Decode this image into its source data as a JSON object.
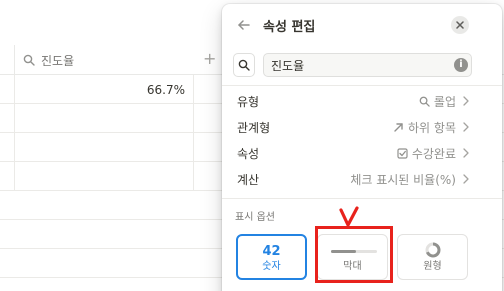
{
  "background_table": {
    "header_label": "진도율",
    "header_icon": "search-icon",
    "add_column_glyph": "+",
    "rows": [
      {
        "value": "66.7%"
      },
      {
        "value": ""
      },
      {
        "value": ""
      },
      {
        "value": ""
      },
      {
        "value": ""
      },
      {
        "value": ""
      },
      {
        "value": ""
      }
    ]
  },
  "panel": {
    "title": "속성 편집",
    "name_input_value": "진도율",
    "info_glyph": "i",
    "properties": [
      {
        "label": "유형",
        "value": "롤업",
        "icon": "search-icon"
      },
      {
        "label": "관계형",
        "value": "하위 항목",
        "icon": "arrow-up-right-icon"
      },
      {
        "label": "속성",
        "value": "수강완료",
        "icon": "checkbox-icon"
      },
      {
        "label": "계산",
        "value": "체크 표시된 비율(%)",
        "icon": ""
      }
    ],
    "display_options_label": "표시 옵션",
    "display_options": {
      "number": {
        "top": "42",
        "label": "숫자",
        "selected": true
      },
      "bar": {
        "label": "막대",
        "selected": false,
        "fill_fraction": 0.55
      },
      "ring": {
        "label": "원형",
        "selected": false
      }
    }
  },
  "colors": {
    "accent": "#2383e2",
    "annotation": "#e8221c",
    "muted_text": "#91918e"
  }
}
